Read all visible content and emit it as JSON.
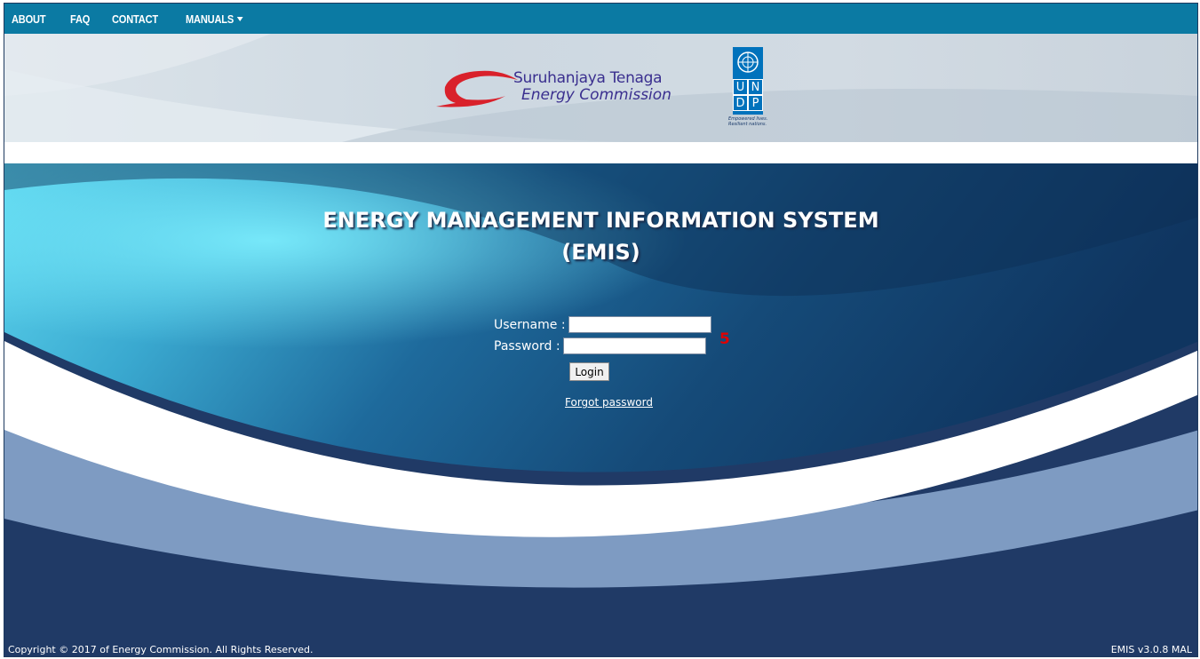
{
  "nav": {
    "items": [
      {
        "label": "ABOUT"
      },
      {
        "label": "FAQ"
      },
      {
        "label": "CONTACT"
      },
      {
        "label": "MANUALS"
      }
    ]
  },
  "header": {
    "logo_line1": "Suruhanjaya Tenaga",
    "logo_line2": "Energy Commission",
    "undp_letters": [
      "U",
      "N",
      "D",
      "P"
    ],
    "undp_tagline_1": "Empowered lives.",
    "undp_tagline_2": "Resilient nations."
  },
  "main": {
    "title_line1": "ENERGY MANAGEMENT INFORMATION SYSTEM",
    "title_line2": "(EMIS)",
    "username_label": "Username :",
    "username_value": "",
    "password_label": "Password :",
    "password_value": "",
    "step_marker": "5",
    "login_label": "Login",
    "forgot_label": "Forgot password"
  },
  "footer": {
    "copyright": "Copyright © 2017 of Energy Commission. All Rights Reserved.",
    "version": "EMIS v3.0.8 MAL"
  },
  "colors": {
    "nav_bg": "#0b7aa3",
    "hero_dark": "#203a66",
    "marker_red": "#e10000"
  }
}
